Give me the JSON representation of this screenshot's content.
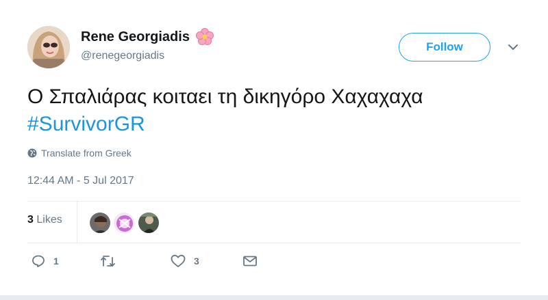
{
  "user": {
    "display_name": "Rene Georgiadis",
    "handle": "@renegeorgiadis",
    "name_emoji": "cherry-blossom-icon"
  },
  "header": {
    "follow_label": "Follow",
    "menu_icon": "chevron-down-icon"
  },
  "tweet": {
    "text": "Ο Σπαλιάρας κοιταει τη δικηγόρο Χαχαχαχα",
    "hashtag": "#SurvivorGR",
    "translate_label": "Translate from Greek",
    "timestamp": "12:44 AM - 5 Jul 2017"
  },
  "stats": {
    "likes_count": "3",
    "likes_label": "Likes"
  },
  "actions": {
    "reply_count": "1",
    "retweet_count": "",
    "like_count": "3"
  },
  "colors": {
    "accent": "#1da1f2",
    "hashtag": "#1b95e0",
    "muted": "#657786",
    "text": "#14171a",
    "divider": "#e6ecf0"
  }
}
